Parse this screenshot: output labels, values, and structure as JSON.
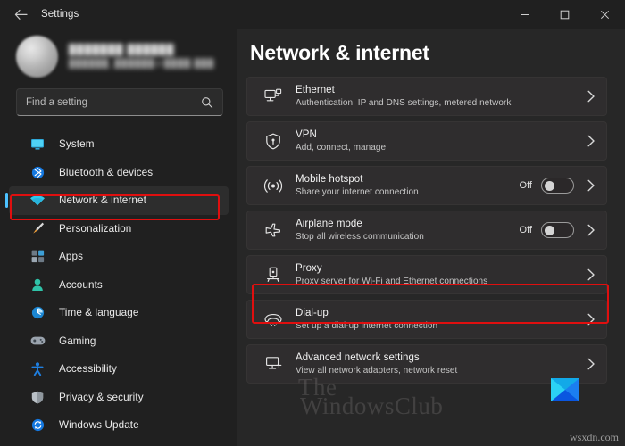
{
  "window": {
    "title": "Settings",
    "back_icon": "back-arrow-icon",
    "minimize_label": "–",
    "maximize_label": "□",
    "close_label": "✕"
  },
  "account": {
    "name": "███████ ██████",
    "email": "██████_██████@████.███"
  },
  "search": {
    "placeholder": "Find a setting",
    "value": "",
    "icon": "search-icon"
  },
  "sidebar": {
    "items": [
      {
        "label": "System",
        "icon": "monitor-icon",
        "selected": false
      },
      {
        "label": "Bluetooth & devices",
        "icon": "bluetooth-icon",
        "selected": false
      },
      {
        "label": "Network & internet",
        "icon": "wifi-icon",
        "selected": true
      },
      {
        "label": "Personalization",
        "icon": "paintbrush-icon",
        "selected": false
      },
      {
        "label": "Apps",
        "icon": "apps-grid-icon",
        "selected": false
      },
      {
        "label": "Accounts",
        "icon": "person-icon",
        "selected": false
      },
      {
        "label": "Time & language",
        "icon": "clock-icon",
        "selected": false
      },
      {
        "label": "Gaming",
        "icon": "gamepad-icon",
        "selected": false
      },
      {
        "label": "Accessibility",
        "icon": "accessibility-person-icon",
        "selected": false
      },
      {
        "label": "Privacy & security",
        "icon": "shield-icon",
        "selected": false
      },
      {
        "label": "Windows Update",
        "icon": "update-arrows-icon",
        "selected": false
      }
    ]
  },
  "main": {
    "page_title": "Network & internet",
    "cards": [
      {
        "title": "Ethernet",
        "subtitle": "Authentication, IP and DNS settings, metered network",
        "icon": "ethernet-monitor-icon",
        "has_toggle": false,
        "state": "",
        "highlighted": false
      },
      {
        "title": "VPN",
        "subtitle": "Add, connect, manage",
        "icon": "vpn-shield-icon",
        "has_toggle": false,
        "state": "",
        "highlighted": false
      },
      {
        "title": "Mobile hotspot",
        "subtitle": "Share your internet connection",
        "icon": "hotspot-broadcast-icon",
        "has_toggle": true,
        "state": "Off",
        "highlighted": false
      },
      {
        "title": "Airplane mode",
        "subtitle": "Stop all wireless communication",
        "icon": "airplane-icon",
        "has_toggle": true,
        "state": "Off",
        "highlighted": false
      },
      {
        "title": "Proxy",
        "subtitle": "Proxy server for Wi-Fi and Ethernet connections",
        "icon": "proxy-server-icon",
        "has_toggle": false,
        "state": "",
        "highlighted": true
      },
      {
        "title": "Dial-up",
        "subtitle": "Set up a dial-up internet connection",
        "icon": "telephone-handset-icon",
        "has_toggle": false,
        "state": "",
        "highlighted": false
      },
      {
        "title": "Advanced network settings",
        "subtitle": "View all network adapters, network reset",
        "icon": "advanced-network-monitor-icon",
        "has_toggle": false,
        "state": "",
        "highlighted": false
      }
    ]
  },
  "watermark": {
    "line1": "The",
    "line2": "WindowsClub",
    "credit": "wsxdn.com",
    "logo": "windowsclub-logo-icon"
  },
  "colors": {
    "accent": "#4cc2ff",
    "annotation": "#e00f0f",
    "page_bg": "#272727",
    "sidebar_bg": "#202020",
    "card_bg": "#2f2d2e"
  }
}
